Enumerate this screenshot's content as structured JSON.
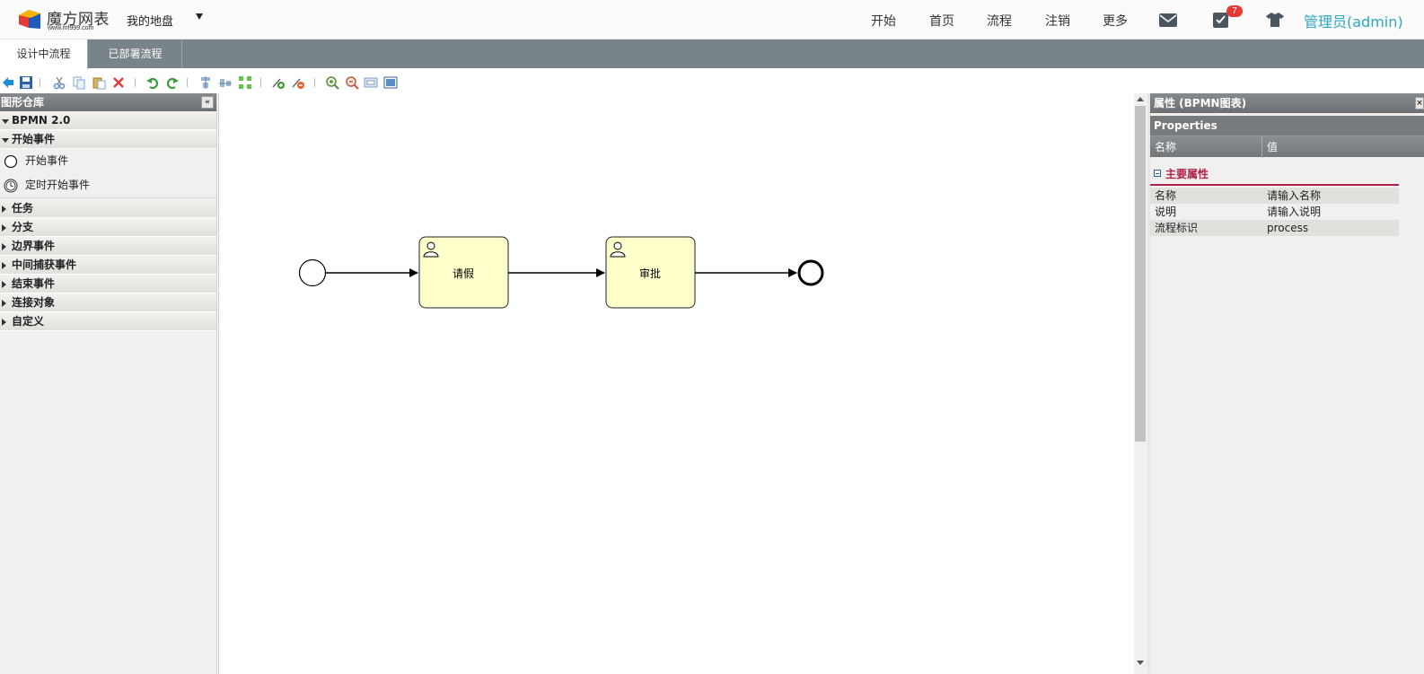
{
  "header": {
    "logo_name": "魔方网表",
    "logo_url": "www.mf999.com",
    "drive_label": "我的地盘",
    "nav": [
      "开始",
      "首页",
      "流程",
      "注销",
      "更多"
    ],
    "badge_count": "7",
    "user": "管理员(admin)"
  },
  "tabs": [
    "设计中流程",
    "已部署流程"
  ],
  "palette": {
    "title": "图形仓库",
    "collapse_glyph": "«",
    "root": "BPMN 2.0",
    "open_group": "开始事件",
    "stencils": [
      "开始事件",
      "定时开始事件"
    ],
    "groups": [
      "任务",
      "分支",
      "边界事件",
      "中间捕获事件",
      "结束事件",
      "连接对象",
      "自定义"
    ]
  },
  "diagram": {
    "tasks": [
      {
        "name": "请假"
      },
      {
        "name": "审批"
      }
    ]
  },
  "properties": {
    "title": "属性 (BPMN图表)",
    "close_glyph": "×",
    "subtitle": "Properties",
    "col_name": "名称",
    "col_value": "值",
    "section": "主要属性",
    "rows": [
      {
        "key": "名称",
        "value": "请输入名称"
      },
      {
        "key": "说明",
        "value": "请输入说明"
      },
      {
        "key": "流程标识",
        "value": "process"
      }
    ]
  },
  "colors": {
    "nav_bar": "#798489",
    "user_link": "#2ba7c5",
    "task_fill": "#ffffcc",
    "section_accent": "#b0204a"
  }
}
